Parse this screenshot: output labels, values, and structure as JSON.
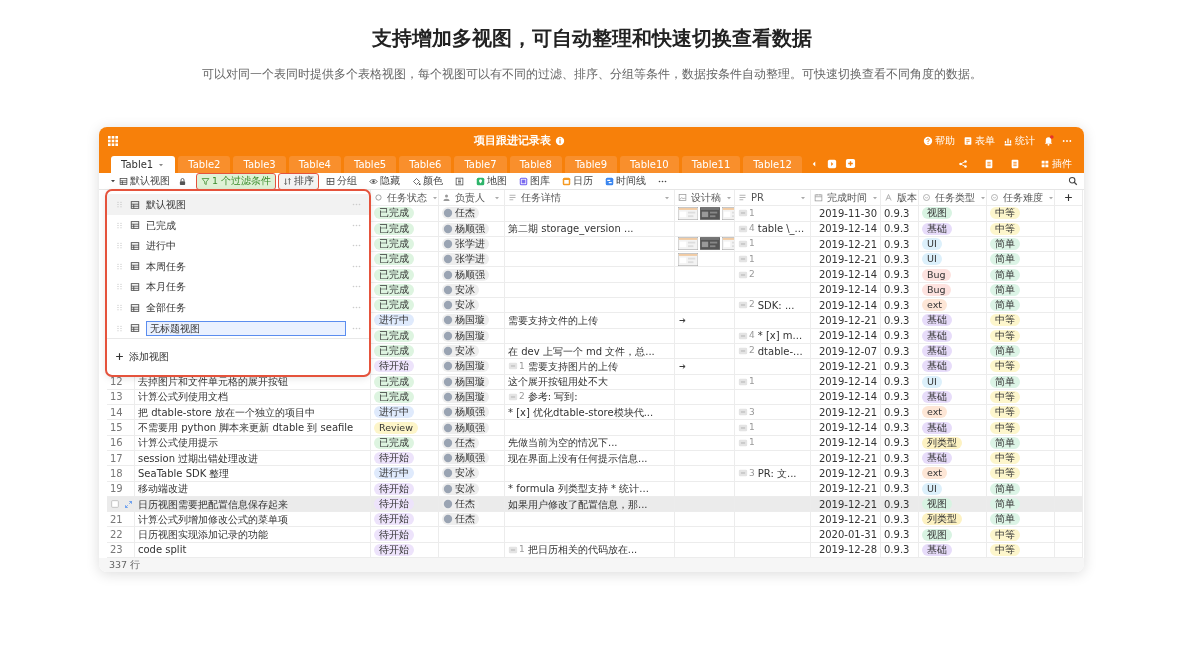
{
  "page": {
    "title": "支持增加多视图，可自动整理和快速切换查看数据",
    "subtitle": "可以对同一个表同时提供多个表格视图，每个视图可以有不同的过滤、排序、分组等条件，数据按条件自动整理。可快速切换查看不同角度的数据。"
  },
  "app": {
    "title": "项目跟进记录表",
    "header_actions": [
      {
        "kind": "help",
        "label": "帮助"
      },
      {
        "kind": "form",
        "label": "表单"
      },
      {
        "kind": "stats",
        "label": "统计"
      },
      {
        "kind": "bell"
      },
      {
        "kind": "more"
      }
    ],
    "tabs": [
      {
        "label": "Table1",
        "selected": true
      },
      {
        "label": "Table2",
        "selected": false
      },
      {
        "label": "Table3",
        "selected": false
      },
      {
        "label": "Table4",
        "selected": false
      },
      {
        "label": "Table5",
        "selected": false
      },
      {
        "label": "Table6",
        "selected": false
      },
      {
        "label": "Table7",
        "selected": false
      },
      {
        "label": "Table8",
        "selected": false
      },
      {
        "label": "Table9",
        "selected": false
      },
      {
        "label": "Table10",
        "selected": false
      },
      {
        "label": "Table11",
        "selected": false
      },
      {
        "label": "Table12",
        "selected": false
      }
    ],
    "plugins_label": "插件",
    "toolbar": {
      "view": "默认视图",
      "items": [
        {
          "kind": "filter",
          "label": "1 个过滤条件",
          "highlighted": true
        },
        {
          "kind": "sort",
          "label": "排序",
          "highlighted": true
        },
        {
          "kind": "group",
          "label": "分组",
          "highlighted": false
        },
        {
          "kind": "hide",
          "label": "隐藏",
          "highlighted": false
        },
        {
          "kind": "color",
          "label": "颜色",
          "highlighted": false
        },
        {
          "kind": "rowheight",
          "highlighted": false
        },
        {
          "kind": "map",
          "label": "地图",
          "highlighted": false
        },
        {
          "kind": "gallery",
          "label": "图库",
          "highlighted": false
        },
        {
          "kind": "calendar",
          "label": "日历",
          "highlighted": false
        },
        {
          "kind": "timeline",
          "label": "时间线",
          "highlighted": false
        },
        {
          "kind": "more",
          "highlighted": false
        }
      ]
    },
    "view_menu": {
      "highlighted": true,
      "add_label": "添加视图",
      "views": [
        {
          "name": "默认视图",
          "selected": true,
          "editing": false
        },
        {
          "name": "已完成",
          "selected": false,
          "editing": false
        },
        {
          "name": "进行中",
          "selected": false,
          "editing": false
        },
        {
          "name": "本周任务",
          "selected": false,
          "editing": false
        },
        {
          "name": "本月任务",
          "selected": false,
          "editing": false
        },
        {
          "name": "全部任务",
          "selected": false,
          "editing": false
        },
        {
          "name": "无标题视图",
          "selected": false,
          "editing": true
        }
      ]
    },
    "table": {
      "columns": [
        {
          "kind": "status",
          "label": "任务状态"
        },
        {
          "kind": "owner",
          "label": "负责人"
        },
        {
          "kind": "detail",
          "label": "任务详情"
        },
        {
          "kind": "design",
          "label": "设计稿"
        },
        {
          "kind": "pr",
          "label": "PR"
        },
        {
          "kind": "date",
          "label": "完成时间"
        },
        {
          "kind": "version",
          "label": "版本"
        },
        {
          "kind": "type",
          "label": "任务类型"
        },
        {
          "kind": "level",
          "label": "任务难度"
        }
      ],
      "rows": [
        {
          "hovered": false,
          "status": {
            "text": "已完成",
            "color": "#ddf4e0"
          },
          "owner": "任杰",
          "pr": {
            "count": "1"
          },
          "date": "2019-11-30",
          "version": "0.9.3",
          "type": {
            "text": "视图",
            "color": "#d8f3e2"
          },
          "level": {
            "text": "中等",
            "color": "#fdf6cc"
          }
        },
        {
          "hovered": false,
          "status": {
            "text": "已完成",
            "color": "#ddf4e0"
          },
          "owner": "杨顺强",
          "detail": {
            "text": "第二期 storage_version ..."
          },
          "pr": {
            "count": "4",
            "text": "table \\_..."
          },
          "date": "2019-12-14",
          "version": "0.9.3",
          "type": {
            "text": "基础",
            "color": "#e7dcfa"
          },
          "level": {
            "text": "中等",
            "color": "#fdf6cc"
          }
        },
        {
          "hovered": false,
          "status": {
            "text": "已完成",
            "color": "#ddf4e0"
          },
          "owner": "张学进",
          "pr": {
            "count": "1"
          },
          "date": "2019-12-21",
          "version": "0.9.3",
          "type": {
            "text": "UI",
            "color": "#dcf0fb"
          },
          "level": {
            "text": "简单",
            "color": "#dcf4e6"
          }
        },
        {
          "hovered": false,
          "status": {
            "text": "已完成",
            "color": "#ddf4e0"
          },
          "owner": "张学进",
          "pr": {
            "count": "1"
          },
          "date": "2019-12-21",
          "version": "0.9.3",
          "type": {
            "text": "UI",
            "color": "#dcf0fb"
          },
          "level": {
            "text": "简单",
            "color": "#dcf4e6"
          }
        },
        {
          "hovered": false,
          "status": {
            "text": "已完成",
            "color": "#ddf4e0"
          },
          "owner": "杨顺强",
          "pr": {
            "count": "2"
          },
          "date": "2019-12-14",
          "version": "0.9.3",
          "type": {
            "text": "Bug",
            "color": "#fde2df"
          },
          "level": {
            "text": "简单",
            "color": "#dcf4e6"
          }
        },
        {
          "hovered": false,
          "status": {
            "text": "已完成",
            "color": "#ddf4e0"
          },
          "owner": "安冰",
          "date": "2019-12-14",
          "version": "0.9.3",
          "type": {
            "text": "Bug",
            "color": "#fde2df"
          },
          "level": {
            "text": "简单",
            "color": "#dcf4e6"
          }
        },
        {
          "hovered": false,
          "status": {
            "text": "已完成",
            "color": "#ddf4e0"
          },
          "owner": "安冰",
          "pr": {
            "count": "2",
            "text": "SDK: ..."
          },
          "date": "2019-12-14",
          "version": "0.9.3",
          "type": {
            "text": "ext",
            "color": "#fde6d6"
          },
          "level": {
            "text": "简单",
            "color": "#dcf4e6"
          }
        },
        {
          "hovered": false,
          "status": {
            "text": "进行中",
            "color": "#dfeafc"
          },
          "owner": "杨国璇",
          "detail": {
            "text": "需要支持文件的上传"
          },
          "design": [
            {
              "kind": "icon"
            }
          ],
          "date": "2019-12-21",
          "version": "0.9.3",
          "type": {
            "text": "基础",
            "color": "#e7dcfa"
          },
          "level": {
            "text": "中等",
            "color": "#fdf6cc"
          }
        },
        {
          "hovered": false,
          "status": {
            "text": "已完成",
            "color": "#ddf4e0"
          },
          "owner": "杨国璇",
          "pr": {
            "count": "4",
            "text": "* [x] m..."
          },
          "date": "2019-12-14",
          "version": "0.9.3",
          "type": {
            "text": "基础",
            "color": "#e7dcfa"
          },
          "level": {
            "text": "中等",
            "color": "#fdf6cc"
          }
        },
        {
          "hovered": false,
          "status": {
            "text": "已完成",
            "color": "#ddf4e0"
          },
          "owner": "安冰",
          "detail": {
            "text": "在 dev 上写一个 md 文件，总..."
          },
          "pr": {
            "count": "2",
            "text": "dtable-..."
          },
          "date": "2019-12-07",
          "version": "0.9.3",
          "type": {
            "text": "基础",
            "color": "#e7dcfa"
          },
          "level": {
            "text": "简单",
            "color": "#dcf4e6"
          }
        },
        {
          "hovered": false,
          "status": {
            "text": "待开始",
            "color": "#ede3fb"
          },
          "owner": "杨国璇",
          "detail": {
            "count": "1",
            "text": "需要支持图片的上传"
          },
          "design": [
            {
              "kind": "icon"
            }
          ],
          "date": "2019-12-21",
          "version": "0.9.3",
          "type": {
            "text": "基础",
            "color": "#e7dcfa"
          },
          "level": {
            "text": "中等",
            "color": "#fdf6cc"
          }
        },
        {
          "hovered": false,
          "number": "12",
          "title": "去掉图片和文件单元格的展开按钮",
          "status": {
            "text": "已完成",
            "color": "#ddf4e0"
          },
          "owner": "杨国璇",
          "detail": {
            "text": "这个展开按钮用处不大"
          },
          "pr": {
            "count": "1"
          },
          "date": "2019-12-14",
          "version": "0.9.3",
          "type": {
            "text": "UI",
            "color": "#dcf0fb"
          },
          "level": {
            "text": "简单",
            "color": "#dcf4e6"
          }
        },
        {
          "hovered": false,
          "number": "13",
          "title": "计算公式列使用文档",
          "status": {
            "text": "已完成",
            "color": "#ddf4e0"
          },
          "owner": "杨国璇",
          "detail": {
            "count": "2",
            "text": "参考: 写到:"
          },
          "date": "2019-12-14",
          "version": "0.9.3",
          "type": {
            "text": "基础",
            "color": "#e7dcfa"
          },
          "level": {
            "text": "中等",
            "color": "#fdf6cc"
          }
        },
        {
          "hovered": false,
          "number": "14",
          "title": "把 dtable-store 放在一个独立的项目中",
          "status": {
            "text": "进行中",
            "color": "#dfeafc"
          },
          "owner": "杨顺强",
          "detail": {
            "text": "* [x] 优化dtable-store模块代..."
          },
          "pr": {
            "count": "3"
          },
          "date": "2019-12-21",
          "version": "0.9.3",
          "type": {
            "text": "ext",
            "color": "#fde6d6"
          },
          "level": {
            "text": "中等",
            "color": "#fdf6cc"
          }
        },
        {
          "hovered": false,
          "number": "15",
          "title": "不需要用 python 脚本来更新 dtable 到 seafile",
          "status": {
            "text": "Review",
            "color": "#fdf5c9"
          },
          "owner": "杨顺强",
          "pr": {
            "count": "1"
          },
          "date": "2019-12-14",
          "version": "0.9.3",
          "type": {
            "text": "基础",
            "color": "#e7dcfa"
          },
          "level": {
            "text": "中等",
            "color": "#fdf6cc"
          }
        },
        {
          "hovered": false,
          "number": "16",
          "title": "计算公式使用提示",
          "status": {
            "text": "已完成",
            "color": "#ddf4e0"
          },
          "owner": "任杰",
          "detail": {
            "text": "先做当前为空的情况下..."
          },
          "pr": {
            "count": "1"
          },
          "date": "2019-12-14",
          "version": "0.9.3",
          "type": {
            "text": "列类型",
            "color": "#fdf2c2"
          },
          "level": {
            "text": "简单",
            "color": "#dcf4e6"
          }
        },
        {
          "hovered": false,
          "number": "17",
          "title": "session 过期出错处理改进",
          "status": {
            "text": "待开始",
            "color": "#ede3fb"
          },
          "owner": "杨顺强",
          "detail": {
            "text": "现在界面上没有任何提示信息..."
          },
          "date": "2019-12-21",
          "version": "0.9.3",
          "type": {
            "text": "基础",
            "color": "#e7dcfa"
          },
          "level": {
            "text": "中等",
            "color": "#fdf6cc"
          }
        },
        {
          "hovered": false,
          "number": "18",
          "title": "SeaTable SDK 整理",
          "status": {
            "text": "进行中",
            "color": "#dfeafc"
          },
          "owner": "安冰",
          "pr": {
            "count": "3",
            "text": "PR: 文..."
          },
          "date": "2019-12-21",
          "version": "0.9.3",
          "type": {
            "text": "ext",
            "color": "#fde6d6"
          },
          "level": {
            "text": "中等",
            "color": "#fdf6cc"
          }
        },
        {
          "hovered": false,
          "number": "19",
          "title": "移动端改进",
          "status": {
            "text": "待开始",
            "color": "#ede3fb"
          },
          "owner": "安冰",
          "detail": {
            "text": "* formula 列类型支持 * 统计..."
          },
          "date": "2019-12-21",
          "version": "0.9.3",
          "type": {
            "text": "UI",
            "color": "#dcf0fb"
          },
          "level": {
            "text": "简单",
            "color": "#dcf4e6"
          }
        },
        {
          "hovered": true,
          "title": "日历视图需要把配置信息保存起来",
          "status": {
            "text": "待开始",
            "color": "#ede3fb"
          },
          "owner": "任杰",
          "detail": {
            "text": "如果用户修改了配置信息，那..."
          },
          "date": "2019-12-21",
          "version": "0.9.3",
          "type": {
            "text": "视图",
            "color": "#d8f3e2"
          },
          "level": {
            "text": "简单",
            "color": "#dcf4e6"
          }
        },
        {
          "hovered": false,
          "number": "21",
          "title": "计算公式列增加修改公式的菜单项",
          "status": {
            "text": "待开始",
            "color": "#ede3fb"
          },
          "owner": "任杰",
          "date": "2019-12-21",
          "version": "0.9.3",
          "type": {
            "text": "列类型",
            "color": "#fdf2c2"
          },
          "level": {
            "text": "简单",
            "color": "#dcf4e6"
          }
        },
        {
          "hovered": false,
          "number": "22",
          "title": "日历视图实现添加记录的功能",
          "status": {
            "text": "待开始",
            "color": "#ede3fb"
          },
          "date": "2020-01-31",
          "version": "0.9.3",
          "type": {
            "text": "视图",
            "color": "#d8f3e2"
          },
          "level": {
            "text": "中等",
            "color": "#fdf6cc"
          }
        },
        {
          "hovered": false,
          "number": "23",
          "title": "code split",
          "status": {
            "text": "待开始",
            "color": "#ede3fb"
          },
          "detail": {
            "count": "1",
            "text": "把日历相关的代码放在..."
          },
          "date": "2019-12-28",
          "version": "0.9.3",
          "type": {
            "text": "基础",
            "color": "#e7dcfa"
          },
          "level": {
            "text": "中等",
            "color": "#fdf6cc"
          }
        }
      ],
      "footer": "337 行"
    }
  }
}
